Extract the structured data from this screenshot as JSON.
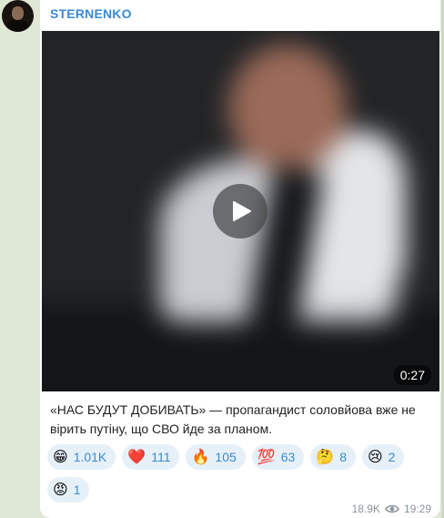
{
  "post": {
    "channel_name": "STERNENKO",
    "video_duration": "0:27",
    "caption": "«НАС БУДУТ ДОБИВАТЬ» — пропагандист соловйова вже не вірить путіну, що СВО йде за планом.",
    "views": "18.9K",
    "time": "19:29"
  },
  "reactions": [
    {
      "emoji": "😁",
      "count": "1.01K"
    },
    {
      "emoji": "❤️",
      "count": "111"
    },
    {
      "emoji": "🔥",
      "count": "105"
    },
    {
      "emoji": "💯",
      "count": "63"
    },
    {
      "emoji": "🤔",
      "count": "8"
    },
    {
      "emoji": "😢",
      "count": "2"
    },
    {
      "emoji": "😡",
      "count": "1"
    }
  ],
  "colors": {
    "accent": "#3a8ad0",
    "reaction_bg": "#e6f0f8",
    "chat_bg": "#dfe8d5"
  },
  "icons": [
    "play-icon",
    "eye-icon"
  ]
}
